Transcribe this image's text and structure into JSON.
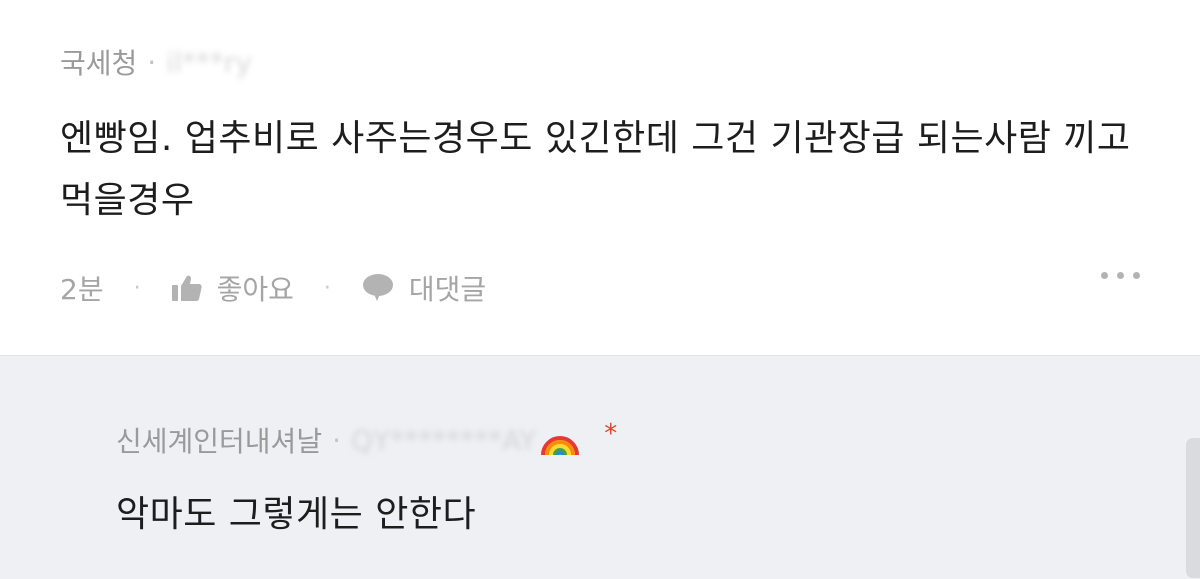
{
  "comment": {
    "author": "국세청",
    "separator": "·",
    "masked_id": "il***ry",
    "text": "엔빵임. 업추비로 사주는경우도 있긴한데 그건 기관장급 되는사람 끼고 먹을경우",
    "time": "2분",
    "meta_separator": "·",
    "like_label": "좋아요",
    "reply_label": "대댓글"
  },
  "reply": {
    "author": "신세계인터내셔날",
    "separator": "·",
    "masked_id": "QY********AY",
    "badge_icon": "rainbow-icon",
    "marker": "*",
    "text": "악마도 그렇게는 안한다"
  },
  "colors": {
    "background": "#ffffff",
    "reply_background": "#eef0f3",
    "muted_text": "#9a9a9a",
    "body_text": "#1d1d1d",
    "marker": "#e0452a"
  }
}
